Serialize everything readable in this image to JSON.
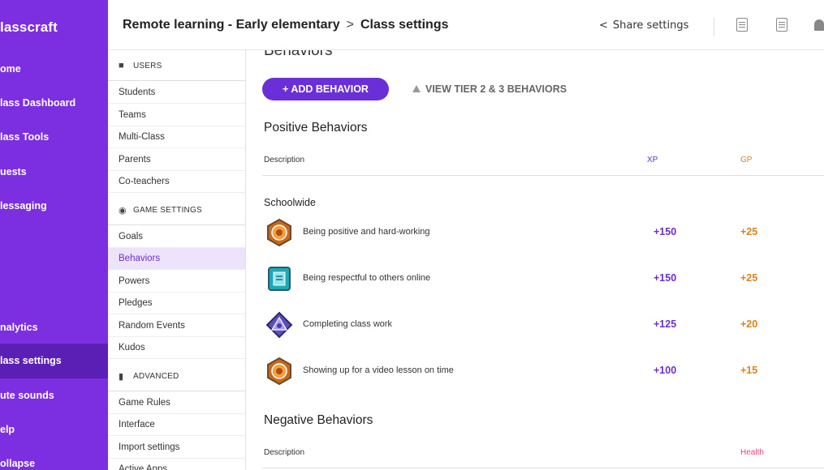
{
  "app": {
    "brand": "lasscraft"
  },
  "leftnav": {
    "items": [
      {
        "label": "ome",
        "active": false
      },
      {
        "label": "lass Dashboard",
        "active": false
      },
      {
        "label": "lass Tools",
        "active": false
      },
      {
        "label": "uests",
        "active": false
      },
      {
        "label": "lessaging",
        "active": false
      },
      {
        "label": "nalytics",
        "active": false
      },
      {
        "label": "lass settings",
        "active": true
      },
      {
        "label": "ute sounds",
        "active": false
      },
      {
        "label": "elp",
        "active": false
      },
      {
        "label": "ollapse",
        "active": false
      }
    ]
  },
  "header": {
    "breadcrumb_parent": "Remote learning - Early elementary",
    "breadcrumb_separator": ">",
    "breadcrumb_current": "Class settings",
    "share_label": "Share settings",
    "share_icon": "share-icon"
  },
  "settings_sidebar": {
    "users_header": "USERS",
    "users_items": [
      "Students",
      "Teams",
      "Multi-Class",
      "Parents",
      "Co-teachers"
    ],
    "game_header": "GAME SETTINGS",
    "game_items": [
      "Goals",
      "Behaviors",
      "Powers",
      "Pledges",
      "Random Events",
      "Kudos"
    ],
    "advanced_header": "ADVANCED",
    "advanced_items": [
      "Game Rules",
      "Interface",
      "Import settings",
      "Active Apps"
    ],
    "active_item": "Behaviors"
  },
  "main": {
    "page_title": "Behaviors",
    "add_button": "+ ADD BEHAVIOR",
    "tier_link": "VIEW TIER 2 & 3 BEHAVIORS",
    "positive": {
      "title": "Positive Behaviors",
      "col_description": "Description",
      "col_xp": "XP",
      "col_gp": "GP",
      "group": "Schoolwide",
      "rows": [
        {
          "description": "Being positive and hard-working",
          "xp": "+150",
          "gp": "+25",
          "badge": "orange-gear-badge-icon"
        },
        {
          "description": "Being respectful to others online",
          "xp": "+150",
          "gp": "+25",
          "badge": "teal-scroll-badge-icon"
        },
        {
          "description": "Completing class work",
          "xp": "+125",
          "gp": "+20",
          "badge": "purple-gem-badge-icon"
        },
        {
          "description": "Showing up for a video lesson on time",
          "xp": "+100",
          "gp": "+15",
          "badge": "orange-gear-badge-icon"
        }
      ]
    },
    "negative": {
      "title": "Negative Behaviors",
      "col_description": "Description",
      "col_health": "Health"
    }
  },
  "colors": {
    "nav_purple": "#7b2fe0",
    "nav_active": "#5b1fb5",
    "accent_purple": "#6a2fd6",
    "gp_orange": "#e0801c",
    "health_pink": "#e8457a"
  }
}
